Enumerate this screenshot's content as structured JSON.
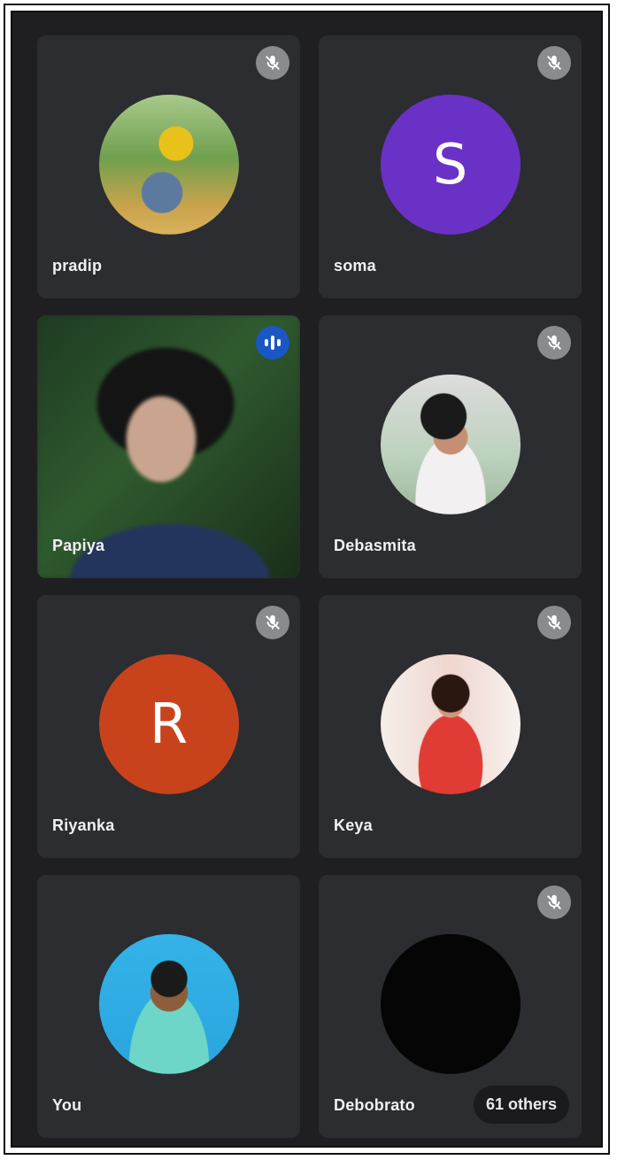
{
  "participants": [
    {
      "name": "pradip",
      "avatar": "photo",
      "muted": true
    },
    {
      "name": "soma",
      "avatar": "initial",
      "initial": "S",
      "color": "#6a31c6",
      "muted": true
    },
    {
      "name": "Papiya",
      "avatar": "video",
      "speaking": true
    },
    {
      "name": "Debasmita",
      "avatar": "photo",
      "muted": true
    },
    {
      "name": "Riyanka",
      "avatar": "initial",
      "initial": "R",
      "color": "#c8431c",
      "muted": true
    },
    {
      "name": "Keya",
      "avatar": "photo",
      "muted": true
    },
    {
      "name": "You",
      "avatar": "photo",
      "muted": false
    },
    {
      "name": "Debobrato",
      "avatar": "black",
      "muted": true
    }
  ],
  "others_label": "61 others",
  "icons": {
    "muted": "mic-off-icon",
    "speaking": "audio-level-icon"
  }
}
